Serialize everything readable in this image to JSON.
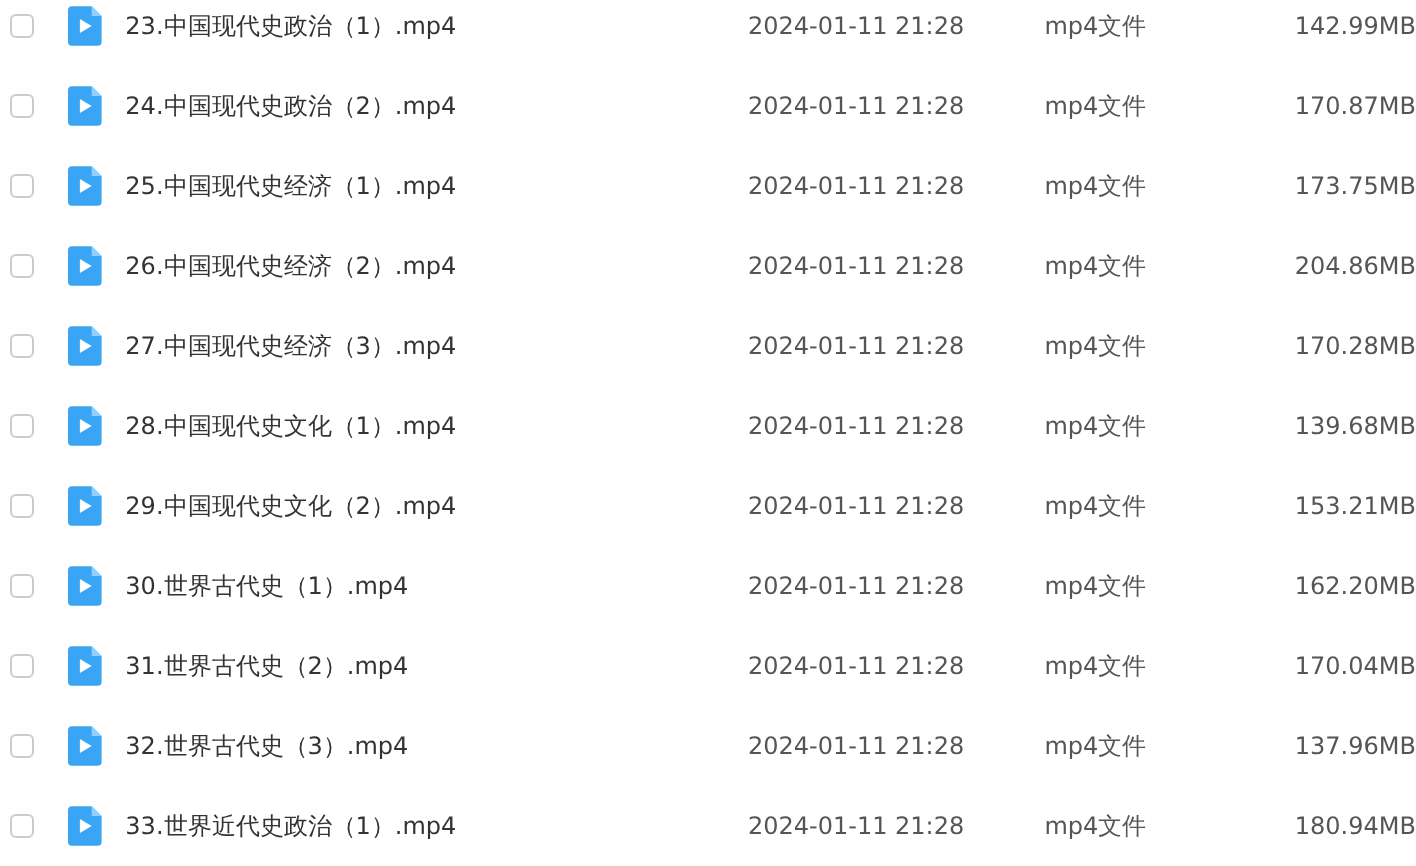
{
  "files": [
    {
      "name": "23.中国现代史政治（1）.mp4",
      "modified": "2024-01-11 21:28",
      "type": "mp4文件",
      "size": "142.99MB",
      "checked": false
    },
    {
      "name": "24.中国现代史政治（2）.mp4",
      "modified": "2024-01-11 21:28",
      "type": "mp4文件",
      "size": "170.87MB",
      "checked": false
    },
    {
      "name": "25.中国现代史经济（1）.mp4",
      "modified": "2024-01-11 21:28",
      "type": "mp4文件",
      "size": "173.75MB",
      "checked": false
    },
    {
      "name": "26.中国现代史经济（2）.mp4",
      "modified": "2024-01-11 21:28",
      "type": "mp4文件",
      "size": "204.86MB",
      "checked": false
    },
    {
      "name": "27.中国现代史经济（3）.mp4",
      "modified": "2024-01-11 21:28",
      "type": "mp4文件",
      "size": "170.28MB",
      "checked": false
    },
    {
      "name": "28.中国现代史文化（1）.mp4",
      "modified": "2024-01-11 21:28",
      "type": "mp4文件",
      "size": "139.68MB",
      "checked": false
    },
    {
      "name": "29.中国现代史文化（2）.mp4",
      "modified": "2024-01-11 21:28",
      "type": "mp4文件",
      "size": "153.21MB",
      "checked": false
    },
    {
      "name": "30.世界古代史（1）.mp4",
      "modified": "2024-01-11 21:28",
      "type": "mp4文件",
      "size": "162.20MB",
      "checked": false
    },
    {
      "name": "31.世界古代史（2）.mp4",
      "modified": "2024-01-11 21:28",
      "type": "mp4文件",
      "size": "170.04MB",
      "checked": false
    },
    {
      "name": "32.世界古代史（3）.mp4",
      "modified": "2024-01-11 21:28",
      "type": "mp4文件",
      "size": "137.96MB",
      "checked": false
    },
    {
      "name": "33.世界近代史政治（1）.mp4",
      "modified": "2024-01-11 21:28",
      "type": "mp4文件",
      "size": "180.94MB",
      "checked": false
    }
  ]
}
